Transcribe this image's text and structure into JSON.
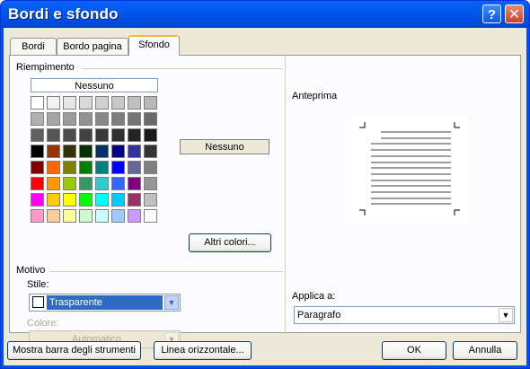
{
  "window": {
    "title": "Bordi e sfondo",
    "help_icon": "?",
    "close_icon": "✕"
  },
  "tabs": [
    {
      "label": "Bordi",
      "active": false
    },
    {
      "label": "Bordo pagina",
      "active": false
    },
    {
      "label": "Sfondo",
      "active": true
    }
  ],
  "fill": {
    "group_label": "Riempimento",
    "none_option": "Nessuno",
    "selected_color_label": "Nessuno",
    "more_colors_button": "Altri colori...",
    "palette": [
      [
        "#ffffff",
        "#f2f2f2",
        "#e6e6e6",
        "#d9d9d9",
        "#d0d0d0",
        "#c8c8c8",
        "#c0c0c0",
        "#b8b8b8"
      ],
      [
        "#b0b0b0",
        "#a6a6a6",
        "#9c9c9c",
        "#929292",
        "#888888",
        "#7e7e7e",
        "#747474",
        "#6a6a6a"
      ],
      [
        "#606060",
        "#565656",
        "#4c4c4c",
        "#424242",
        "#383838",
        "#2e2e2e",
        "#242424",
        "#1a1a1a"
      ],
      [
        "#000000",
        "#993300",
        "#333300",
        "#003300",
        "#003366",
        "#000080",
        "#333399",
        "#333333"
      ],
      [
        "#800000",
        "#ff6600",
        "#808000",
        "#008000",
        "#008080",
        "#0000ff",
        "#666699",
        "#808080"
      ],
      [
        "#ff0000",
        "#ff9900",
        "#99cc00",
        "#339966",
        "#33cccc",
        "#3366ff",
        "#800080",
        "#969696"
      ],
      [
        "#ff00ff",
        "#ffcc00",
        "#ffff00",
        "#00ff00",
        "#00ffff",
        "#00ccff",
        "#993366",
        "#c0c0c0"
      ],
      [
        "#ff99cc",
        "#ffcc99",
        "#ffff99",
        "#ccffcc",
        "#ccffff",
        "#99ccff",
        "#cc99ff",
        "#ffffff"
      ]
    ]
  },
  "pattern": {
    "group_label": "Motivo",
    "style_label": "Stile:",
    "style_value": "Trasparente",
    "color_label": "Colore:",
    "color_value": "Automatico"
  },
  "preview": {
    "group_label": "Anteprima"
  },
  "apply": {
    "label": "Applica a:",
    "value": "Paragrafo"
  },
  "buttons": {
    "toolbar": "Mostra barra degli strumenti",
    "horizontal_line": "Linea orizzontale...",
    "ok": "OK",
    "cancel": "Annulla"
  },
  "colors": {
    "titlebar": "#0058ee",
    "selection": "#316ac5",
    "dialog_bg": "#ece9d8"
  }
}
